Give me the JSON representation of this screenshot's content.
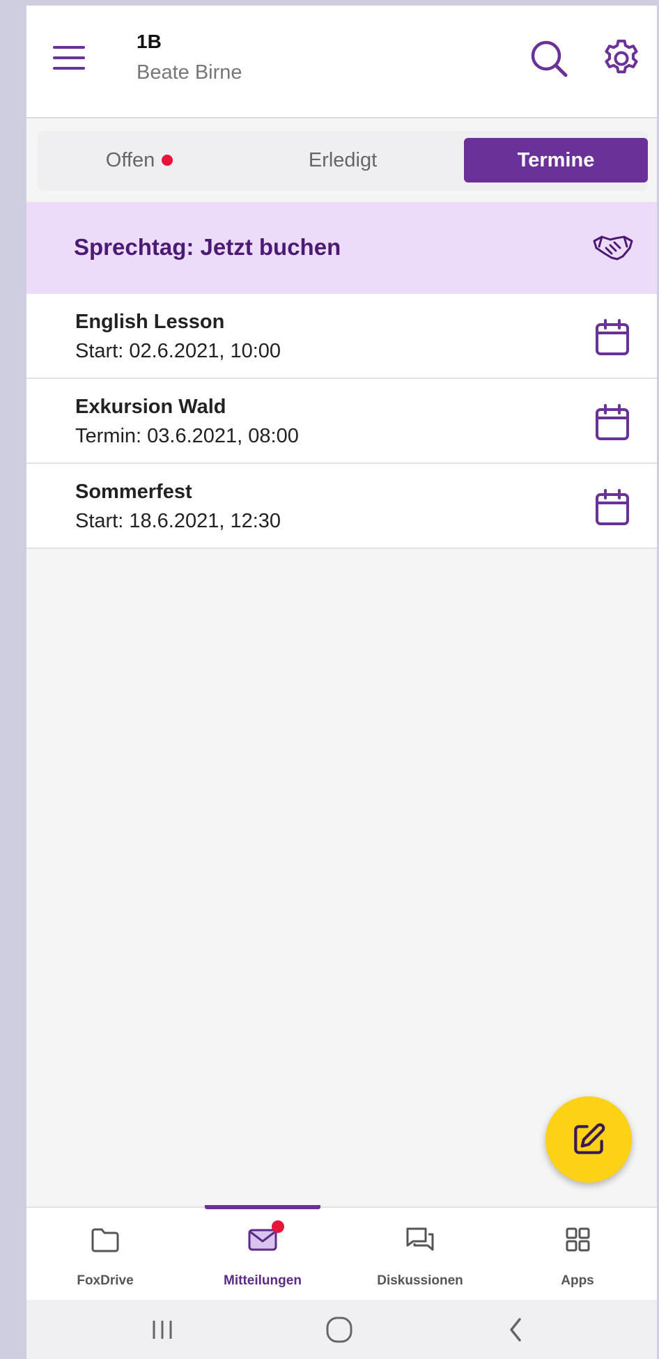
{
  "header": {
    "title": "1B",
    "subtitle": "Beate Birne",
    "menu_icon": "hamburger-menu-icon",
    "search_icon": "search-icon",
    "settings_icon": "gear-icon"
  },
  "tabs": [
    {
      "label": "Offen",
      "has_badge": true,
      "active": false
    },
    {
      "label": "Erledigt",
      "has_badge": false,
      "active": false
    },
    {
      "label": "Termine",
      "has_badge": false,
      "active": true
    }
  ],
  "banner": {
    "text": "Sprechtag: Jetzt buchen",
    "icon": "handshake-icon"
  },
  "events": [
    {
      "title": "English Lesson",
      "subtitle": "Start: 02.6.2021, 10:00",
      "icon": "calendar-icon"
    },
    {
      "title": "Exkursion Wald",
      "subtitle": "Termin: 03.6.2021, 08:00",
      "icon": "calendar-icon"
    },
    {
      "title": "Sommerfest",
      "subtitle": "Start: 18.6.2021, 12:30",
      "icon": "calendar-icon"
    }
  ],
  "fab": {
    "icon": "edit-icon"
  },
  "bottom_nav": [
    {
      "label": "FoxDrive",
      "icon": "folder-icon",
      "active": false
    },
    {
      "label": "Mitteilungen",
      "icon": "mail-icon",
      "active": true,
      "badge": true
    },
    {
      "label": "Diskussionen",
      "icon": "chat-icon",
      "active": false
    },
    {
      "label": "Apps",
      "icon": "apps-grid-icon",
      "active": false
    }
  ],
  "colors": {
    "accent": "#6a3299",
    "banner_bg": "#ecdcf9",
    "banner_text": "#4a1a74",
    "badge": "#e8143c",
    "fab": "#fcd116"
  }
}
